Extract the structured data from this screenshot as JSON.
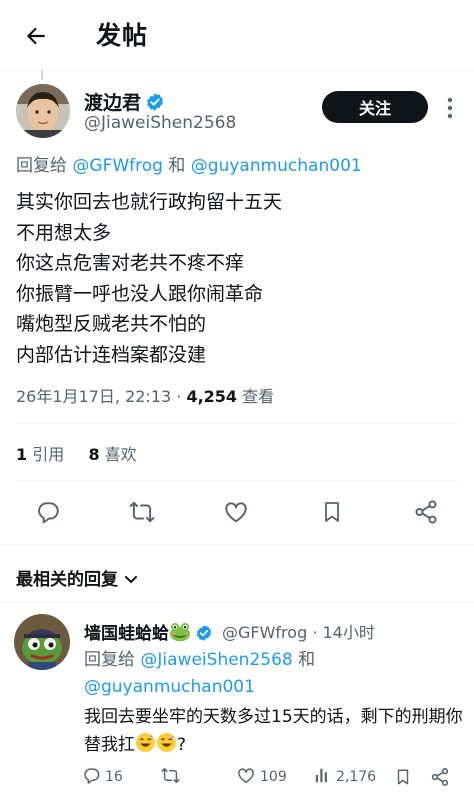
{
  "header": {
    "title": "发帖"
  },
  "tweet": {
    "author_name": "渡边君",
    "author_handle": "@JiaweiShen2568",
    "follow_label": "关注",
    "reply_to_prefix": "回复给 ",
    "reply_to_user1": "@GFWfrog",
    "reply_to_and": " 和 ",
    "reply_to_user2": "@guyanmuchan001",
    "lines": [
      "其实你回去也就行政拘留十五天",
      "不用想太多",
      "你这点危害对老共不疼不痒",
      "你振臂一呼也没人跟你闹革命",
      "嘴炮型反贼老共不怕的",
      "内部估计连档案都没建"
    ],
    "timestamp": "26年1月17日, 22:13 · ",
    "views_count": "4,254",
    "views_label": " 查看",
    "quote_count": "1",
    "quote_label": "引用",
    "like_count": "8",
    "like_label": "喜欢"
  },
  "replies_section": {
    "title": "最相关的回复"
  },
  "reply": {
    "author_name": "墙国蛙蛤蛤",
    "author_handle": "@GFWfrog · 14小时",
    "reply_to_prefix": "回复给 ",
    "reply_to_user1": "@JiaweiShen2568",
    "reply_to_and": " 和",
    "reply_to_user2": "@guyanmuchan001",
    "text": "我回去要坐牢的天数多过15天的话，剩下的刑期你替我扛",
    "text_end": "?",
    "reply_count": "16",
    "like_count": "109",
    "view_count": "2,176"
  },
  "colors": {
    "accent": "#1d9bf0",
    "text_primary": "#0f1419",
    "text_secondary": "#536471",
    "divider": "#eff3f4",
    "follow_bg": "#0f1419"
  },
  "icons": [
    "back-arrow-icon",
    "verified-badge-icon",
    "more-icon",
    "reply-icon",
    "retweet-icon",
    "like-icon",
    "bookmark-icon",
    "share-icon",
    "chevron-down-icon",
    "frog-emoji-icon",
    "sweat-smile-emoji-icon",
    "views-icon"
  ]
}
